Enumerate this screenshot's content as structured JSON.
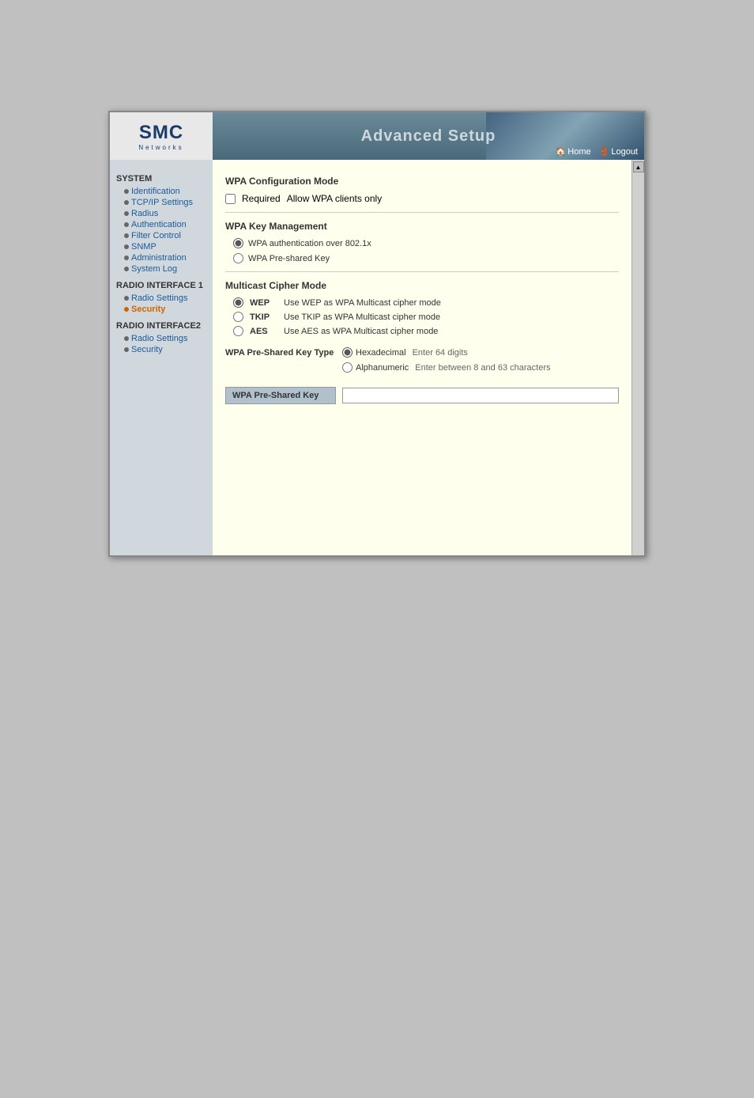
{
  "header": {
    "logo_text": "SMC",
    "logo_sub": "Networks",
    "title": "Advanced Setup",
    "nav_home": "Home",
    "nav_logout": "Logout"
  },
  "sidebar": {
    "system_title": "SYSTEM",
    "system_items": [
      {
        "label": "Identification",
        "active": false
      },
      {
        "label": "TCP/IP Settings",
        "active": false
      },
      {
        "label": "Radius",
        "active": false
      },
      {
        "label": "Authentication",
        "active": false
      },
      {
        "label": "Filter Control",
        "active": false
      },
      {
        "label": "SNMP",
        "active": false
      },
      {
        "label": "Administration",
        "active": false
      },
      {
        "label": "System Log",
        "active": false
      }
    ],
    "radio1_title": "RADIO INTERFACE 1",
    "radio1_items": [
      {
        "label": "Radio Settings",
        "active": false
      },
      {
        "label": "Security",
        "active": true
      }
    ],
    "radio2_title": "RADIO INTERFACE2",
    "radio2_items": [
      {
        "label": "Radio Settings",
        "active": false
      },
      {
        "label": "Security",
        "active": false
      }
    ]
  },
  "main": {
    "wpa_config_title": "WPA Configuration Mode",
    "required_label": "Required",
    "required_desc": "Allow WPA clients only",
    "wpa_key_mgmt_title": "WPA Key Management",
    "wpa_802_label": "WPA authentication over 802.1x",
    "wpa_psk_label": "WPA Pre-shared Key",
    "multicast_title": "Multicast Cipher Mode",
    "cipher_wep_label": "WEP",
    "cipher_wep_desc": "Use WEP as WPA Multicast cipher mode",
    "cipher_tkip_label": "TKIP",
    "cipher_tkip_desc": "Use TKIP  as WPA Multicast cipher mode",
    "cipher_aes_label": "AES",
    "cipher_aes_desc": "Use AES  as WPA Multicast cipher mode",
    "psk_type_label": "WPA Pre-Shared Key Type",
    "hex_label": "Hexadecimal",
    "hex_desc": "Enter 64 digits",
    "alpha_label": "Alphanumeric",
    "alpha_desc": "Enter between 8 and 63 characters",
    "psk_field_label": "WPA Pre-Shared Key",
    "psk_field_value": ""
  }
}
